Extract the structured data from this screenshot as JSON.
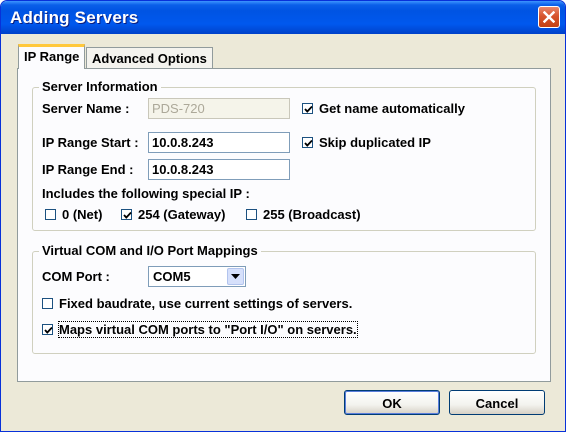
{
  "window": {
    "title": "Adding Servers"
  },
  "tabs": [
    {
      "label": "IP Range",
      "active": true
    },
    {
      "label": "Advanced Options",
      "active": false
    }
  ],
  "server_info": {
    "legend": "Server Information",
    "server_name_label": "Server Name :",
    "server_name_value": "PDS-720",
    "get_name_auto_label": "Get name automatically",
    "get_name_auto_checked": true,
    "ip_start_label": "IP Range Start :",
    "ip_start_value": "10.0.8.243",
    "skip_dup_label": "Skip duplicated IP",
    "skip_dup_checked": true,
    "ip_end_label": "IP Range End :",
    "ip_end_value": "10.0.8.243",
    "special_ip_label": "Includes the following special IP :",
    "special_ips": [
      {
        "label": "0 (Net)",
        "checked": false
      },
      {
        "label": "254 (Gateway)",
        "checked": true
      },
      {
        "label": "255 (Broadcast)",
        "checked": false
      }
    ]
  },
  "mappings": {
    "legend": "Virtual COM and I/O Port Mappings",
    "com_port_label": "COM Port :",
    "com_port_value": "COM5",
    "fixed_baud_label": "Fixed baudrate, use current settings of servers.",
    "fixed_baud_checked": false,
    "map_io_label": "Maps virtual COM ports to \"Port I/O\" on servers.",
    "map_io_checked": true
  },
  "buttons": {
    "ok": "OK",
    "cancel": "Cancel"
  },
  "colors": {
    "titlebar": "#0054e3",
    "dialog_bg": "#ece9d8",
    "panel_bg": "#fcfcfe",
    "check": "#21a121"
  },
  "icons": {
    "close": "close-icon",
    "dropdown": "chevron-down-icon",
    "check": "checkmark-icon"
  }
}
